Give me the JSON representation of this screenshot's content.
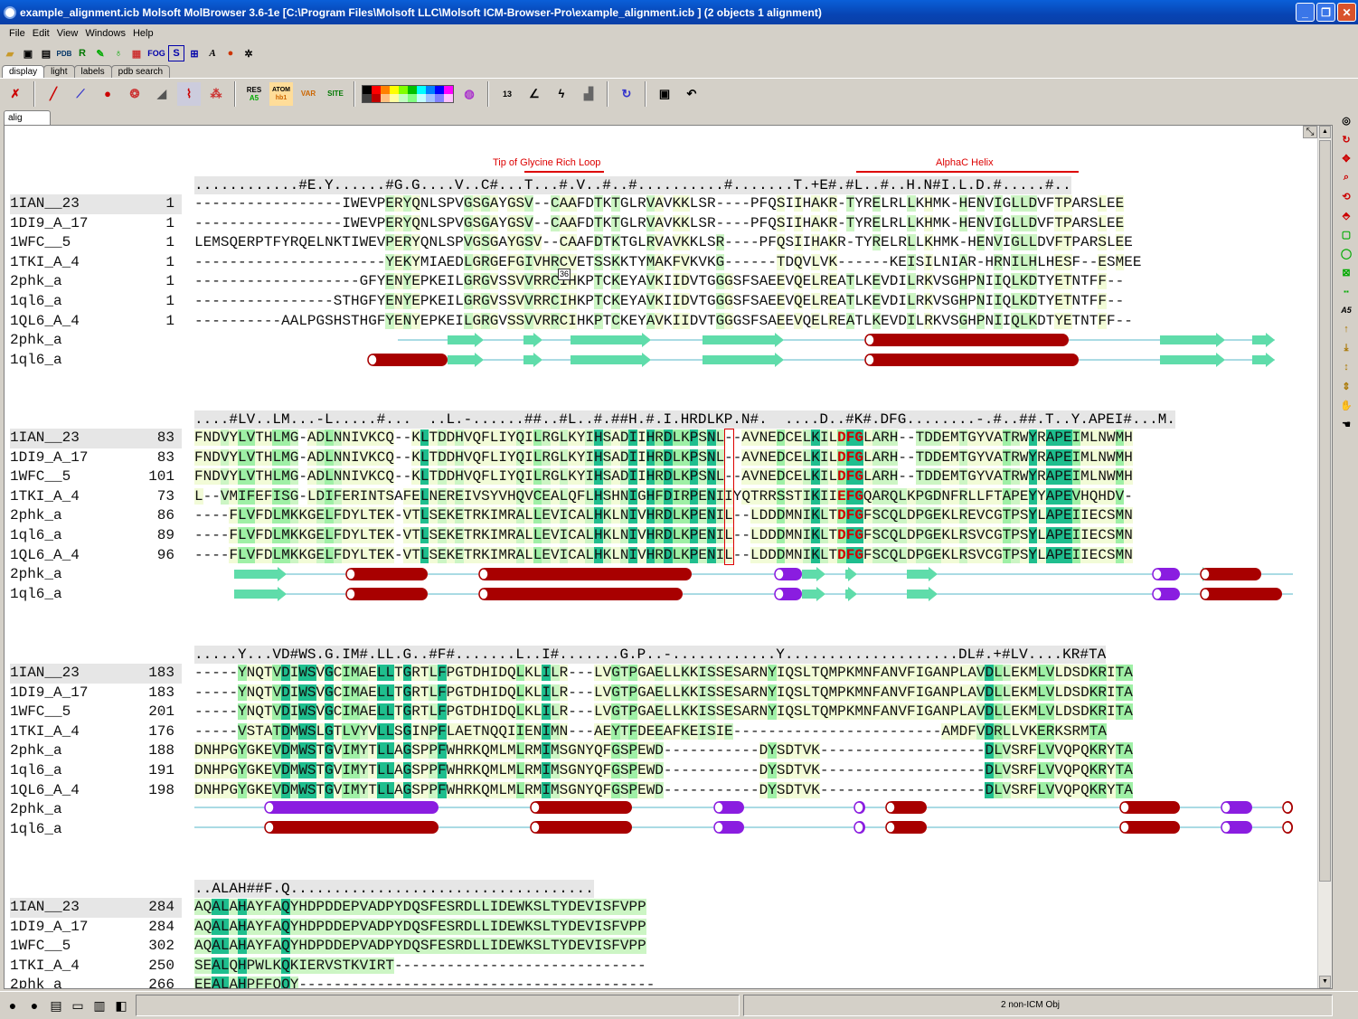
{
  "window": {
    "title": "example_alignment.icb Molsoft MolBrowser 3.6-1e  [C:\\Program Files\\Molsoft LLC\\Molsoft ICM-Browser-Pro\\example_alignment.icb ] (2 objects 1 alignment)",
    "min": "_",
    "max": "❐",
    "close": "✕"
  },
  "menu": [
    "File",
    "Edit",
    "View",
    "Windows",
    "Help"
  ],
  "toolbar_top": {
    "pdb": "PDB",
    "r": "R",
    "fog": "FOG",
    "s": "S",
    "a": "A"
  },
  "panel_tabs": [
    "display",
    "light",
    "labels",
    "pdb search"
  ],
  "toolbar_main": {
    "res": "RES",
    "res_sub": "A5",
    "atom": "ATOM",
    "atom_sub": "hb1",
    "var": "VAR",
    "site": "SITE",
    "num": "13"
  },
  "palette": [
    "#000000",
    "#ff0000",
    "#ff8000",
    "#ffff00",
    "#80ff00",
    "#00c000",
    "#00ffff",
    "#0080ff",
    "#0000ff",
    "#ff00ff",
    "#404040",
    "#c00000",
    "#ffc080",
    "#ffffa0",
    "#c0ffc0",
    "#80ff80",
    "#c0ffff",
    "#a0c0ff",
    "#8080ff",
    "#ffc0ff"
  ],
  "doc_tab": "alig",
  "annotations": {
    "glycine": "Tip of Glycine Rich Loop",
    "alphac": "AlphaC Helix",
    "marker": "36"
  },
  "blocks": [
    {
      "consensus": "............#E.Y......#G.G....V..C#...T...#.V..#..#..........#.......T.+E#.#L..#..H.N#I.L.D.#.....#..",
      "rows": [
        {
          "name": "1IAN__23",
          "num": "1",
          "seq": "-----------------IWEVPERYQNLSPVGSGAYGSV--CAAFDTKTGLRVAVKKLSR----PFQSIIHAKR-TYRELRLLKHMK-HENVIGLLDVFTPARSLEE"
        },
        {
          "name": "1DI9_A_17",
          "num": "1",
          "seq": "-----------------IWEVPERYQNLSPVGSGAYGSV--CAAFDTKTGLRVAVKKLSR----PFQSIIHAKR-TYRELRLLKHMK-HENVIGLLDVFTPARSLEE"
        },
        {
          "name": "1WFC__5",
          "num": "1",
          "seq": "LEMSQERPTFYRQELNKTIWEVPERYQNLSPVGSGAYGSV--CAAFDTKTGLRVAVKKLSR----PFQSIIHAKR-TYRELRLLKHMK-HENVIGLLDVFTPARSLEE"
        },
        {
          "name": "1TKI_A_4",
          "num": "1",
          "seq": "----------------------YEKYMIAEDLGRGEFGIVHRCVETSSKKTYMAKFVKVKG------TDQVLVK------KEISILNIAR-HRNILHLHESF--ESMEE"
        },
        {
          "name": "2phk_a",
          "num": "1",
          "seq": "-------------------GFYENYEPKEILGRGVSSVVRRCIHKPTCKEYAVKIIDVTGGGSFSAEEVQELREATLKEVDILRKVSGHPNIIQLKDTYETNTFF--"
        },
        {
          "name": "1ql6_a",
          "num": "1",
          "seq": "----------------STHGFYENYEPKEILGRGVSSVVRRCIHKPTCKEYAVKIIDVTGGGSFSAEEVQELREATLKEVDILRKVSGHPNIIQLKDTYETNTFF--"
        },
        {
          "name": "1QL6_A_4",
          "num": "1",
          "seq": "----------AALPGSHSTHGFYENYEPKEILGRGVSSVVRRCIHKPTCKEYAVKIIDVTGGGSFSAEEVQELREATLKEVDILRKVSGHPNIIQLKDTYETNTFF--"
        }
      ],
      "ss": [
        {
          "name": "2phk_a"
        },
        {
          "name": "1ql6_a"
        }
      ]
    },
    {
      "consensus": "....#LV..LM...-L.....#...  ..L.-......##..#L..#.##H.#.I.HRDLKP.N#.  ....D..#K#.DFG........-.#..##.T..Y.APEI#...M.",
      "rows": [
        {
          "name": "1IAN__23",
          "num": "83",
          "seq": "FNDVYLVTHLMG-ADLNNIVKCQ--KLTDDHVQFLIYQILRGLKYIHSADIIHRDLKPSNL--AVNEDCELKILDFGLARH--TDDEMTGYVATRWYRAPEIMLNWMH"
        },
        {
          "name": "1DI9_A_17",
          "num": "83",
          "seq": "FNDVYLVTHLMG-ADLNNIVKCQ--KLTDDHVQFLIYQILRGLKYIHSADIIHRDLKPSNL--AVNEDCELKILDFGLARH--TDDEMTGYVATRWYRAPEIMLNWMH"
        },
        {
          "name": "1WFC__5",
          "num": "101",
          "seq": "FNDVYLVTHLMG-ADLNNIVKCQ--KLTDDHVQFLIYQILRGLKYIHSADIIHRDLKPSNL--AVNEDCELKILDFGLARH--TDDEMTGYVATRWYRAPEIMLNWMH"
        },
        {
          "name": "1TKI_A_4",
          "num": "73",
          "seq": "L--VMIFEFISG-LDIFERINTSAFELNEREIVSYVHQVCEALQFLHSHNIGHFDIRPENIIYQTRRSSTIKIIEFGQARQLKPGDNFRLLFTAPEYYAPEVHQHDV-"
        },
        {
          "name": "2phk_a",
          "num": "86",
          "seq": "----FLVFDLMKKGELFDYLTEK-VTLSEKETRKIMRALLEVICALHKLNIVHRDLKPENIL--LDDDMNIKLTDFGFSCQLDPGEKLREVCGTPSYLAPEIIECSMN"
        },
        {
          "name": "1ql6_a",
          "num": "89",
          "seq": "----FLVFDLMKKGELFDYLTEK-VTLSEKETRKIMRALLEVICALHKLNIVHRDLKPENIL--LDDDMNIKLTDFGFSCQLDPGEKLRSVCGTPSYLAPEIIECSMN"
        },
        {
          "name": "1QL6_A_4",
          "num": "96",
          "seq": "----FLVFDLMKKGELFDYLTEK-VTLSEKETRKIMRALLEVICALHKLNIVHRDLKPENIL--LDDDMNIKLTDFGFSCQLDPGEKLRSVCGTPSYLAPEIIECSMN"
        }
      ],
      "ss": [
        {
          "name": "2phk_a"
        },
        {
          "name": "1ql6_a"
        }
      ]
    },
    {
      "consensus": ".....Y...VD#WS.G.IM#.LL.G..#F#.......L..I#.......G.P..-............Y....................DL#.+#LV....KR#TA",
      "rows": [
        {
          "name": "1IAN__23",
          "num": "183",
          "seq": "-----YNQTVDIWSVGCIMAELLTGRTLFPGTDHIDQLKLILR---LVGTPGAELLKKISSESARNYIQSLTQMPKMNFANVFIGANPLAVDLLEKMLVLDSDKRITA"
        },
        {
          "name": "1DI9_A_17",
          "num": "183",
          "seq": "-----YNQTVDIWSVGCIMAELLTGRTLFPGTDHIDQLKLILR---LVGTPGAELLKKISSESARNYIQSLTQMPKMNFANVFIGANPLAVDLLEKMLVLDSDKRITA"
        },
        {
          "name": "1WFC__5",
          "num": "201",
          "seq": "-----YNQTVDIWSVGCIMAELLTGRTLFPGTDHIDQLKLILR---LVGTPGAELLKKISSESARNYIQSLTQMPKMNFANVFIGANPLAVDLLEKMLVLDSDKRITA"
        },
        {
          "name": "1TKI_A_4",
          "num": "176",
          "seq": "-----VSTATDMWSLGTLVYVLLSGINPFLAETNQQIIENIMN---AEYTFDEEAFKEISIE------------------------AMDFVDRLLVKERKSRMTA"
        },
        {
          "name": "2phk_a",
          "num": "188",
          "seq": "DNHPGYGKEVDMWSTGVIMYTLLAGSPPFWHRKQMLMLRMIMSGNYQFGSPEWD-----------DYSDTVK-------------------DLVSRFLVVQPQKRYTA"
        },
        {
          "name": "1ql6_a",
          "num": "191",
          "seq": "DNHPGYGKEVDMWSTGVIMYTLLAGSPPFWHRKQMLMLRMIMSGNYQFGSPEWD-----------DYSDTVK-------------------DLVSRFLVVQPQKRYTA"
        },
        {
          "name": "1QL6_A_4",
          "num": "198",
          "seq": "DNHPGYGKEVDMWSTGVIMYTLLAGSPPFWHRKQMLMLRMIMSGNYQFGSPEWD-----------DYSDTVK-------------------DLVSRFLVVQPQKRYTA"
        }
      ],
      "ss": [
        {
          "name": "2phk_a"
        },
        {
          "name": "1ql6_a"
        }
      ]
    },
    {
      "consensus": "..ALAH##F.Q...................................",
      "rows": [
        {
          "name": "1IAN__23",
          "num": "284",
          "seq": "AQALAHAYFAQYHDPDDEPVADPYDQSFESRDLLIDEWKSLTYDEVISFVPP"
        },
        {
          "name": "1DI9_A_17",
          "num": "284",
          "seq": "AQALAHAYFAQYHDPDDEPVADPYDQSFESRDLLIDEWKSLTYDEVISFVPP"
        },
        {
          "name": "1WFC__5",
          "num": "302",
          "seq": "AQALAHAYFAQYHDPDDEPVADPYDQSFESRDLLIDEWKSLTYDEVISFVPP"
        },
        {
          "name": "1TKI_A_4",
          "num": "250",
          "seq": "SEALQHPWLKQKIERVSTKVIRT-----------------------------"
        },
        {
          "name": "2phk_a",
          "num": "266",
          "seq": "EEALAHPFFQQY-----------------------------------------"
        }
      ]
    }
  ],
  "status": "2 non-ICM Obj"
}
